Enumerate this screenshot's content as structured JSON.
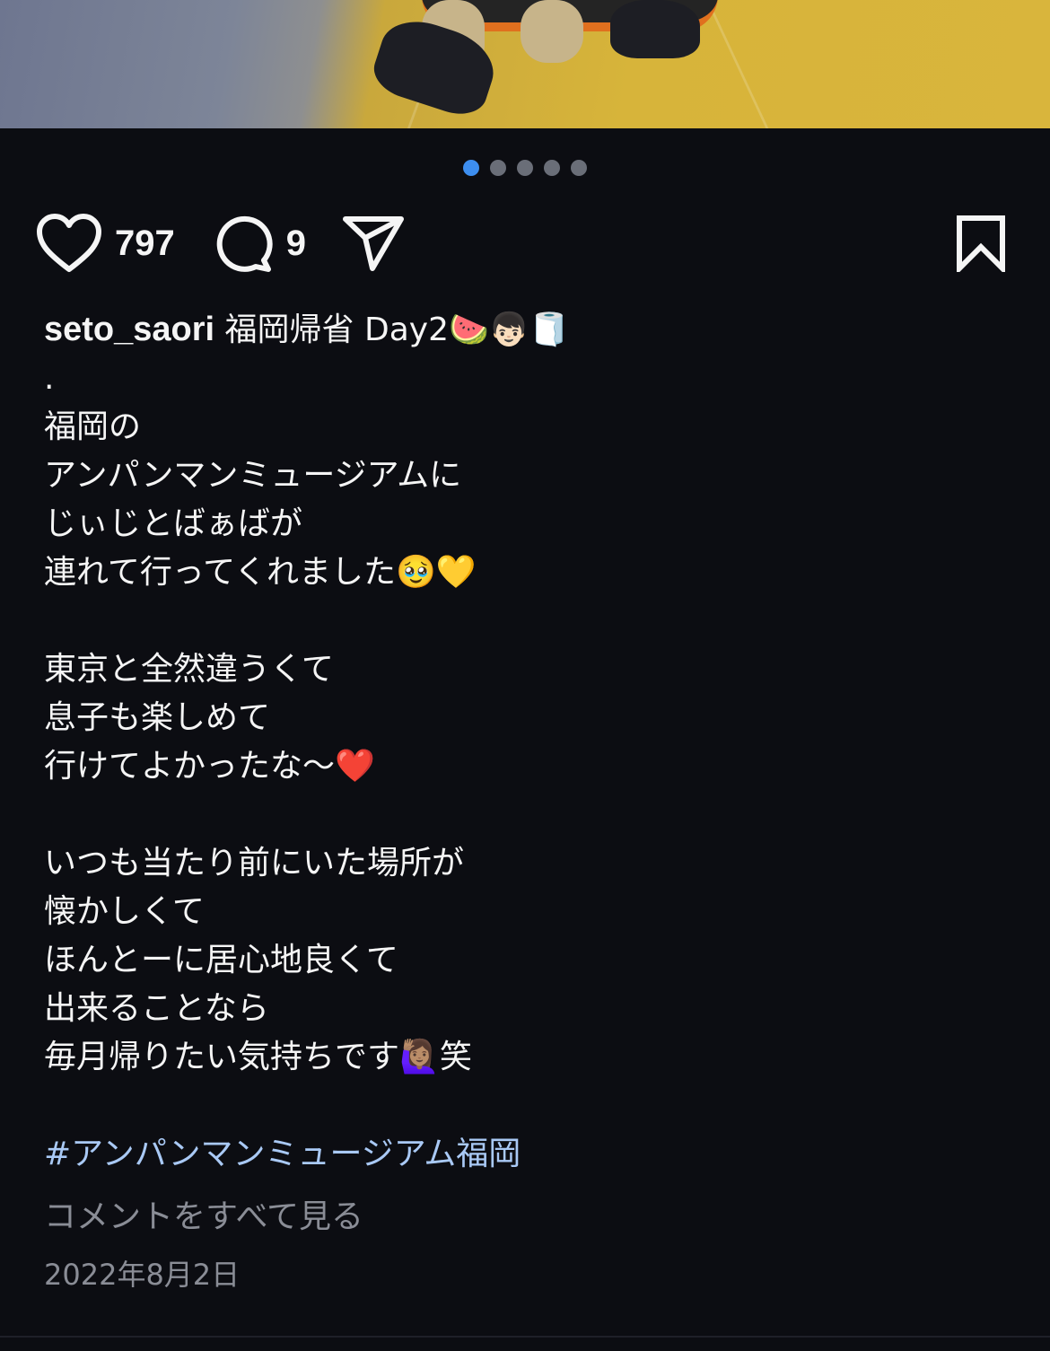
{
  "carousel": {
    "total": 5,
    "active_index": 0
  },
  "actions": {
    "like_count": "797",
    "comment_count": "9"
  },
  "post": {
    "username": "seto_saori",
    "caption_lines": [
      "福岡帰省 Day2🍉👦🏻🧻",
      ".",
      "福岡の",
      "アンパンマンミュージアムに",
      "じぃじとばぁばが",
      "連れて行ってくれました🥹💛",
      "",
      "東京と全然違うくて",
      "息子も楽しめて",
      "行けてよかったな〜❤️",
      "",
      "いつも当たり前にいた場所が",
      "懐かしくて",
      "ほんとーに居心地良くて",
      "出来ることなら",
      "毎月帰りたい気持ちです🙋🏽‍♀️笑"
    ],
    "hashtag": "#アンパンマンミュージアム福岡",
    "view_comments": "コメントをすべて見る",
    "date": "2022年8月2日"
  },
  "colors": {
    "background": "#0c0d12",
    "dot_active": "#3d8ef0",
    "dot_inactive": "#6a6e78",
    "hashtag": "#a9c9f5",
    "muted": "#8a8d96"
  }
}
